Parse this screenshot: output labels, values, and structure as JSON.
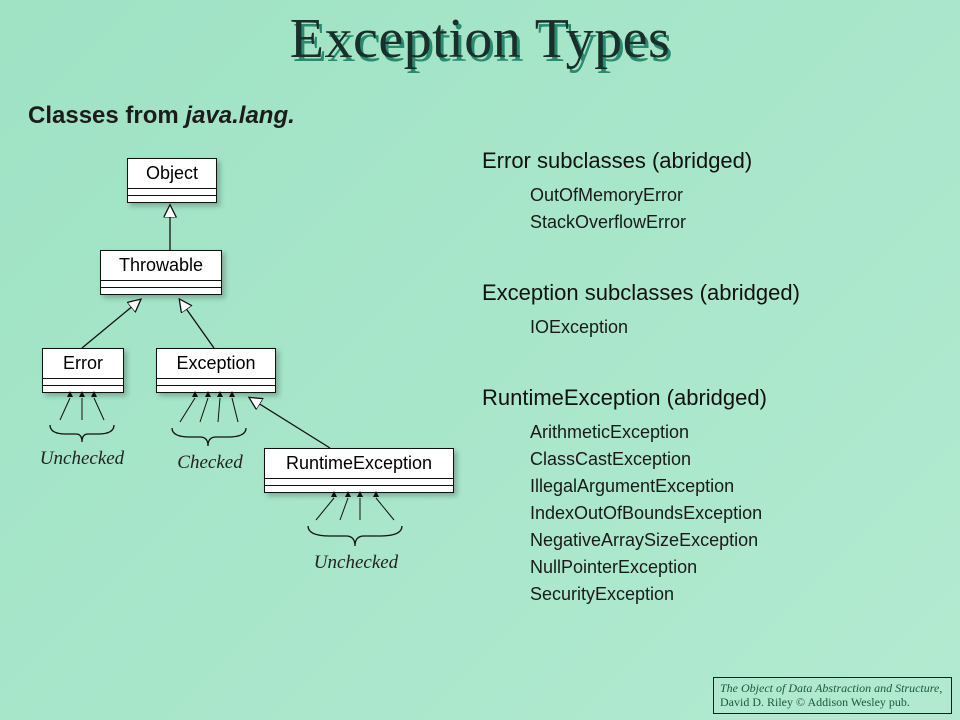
{
  "title": "Exception Types",
  "subtitle_prefix": "Classes from ",
  "subtitle_package": "java.lang.",
  "uml": {
    "object": "Object",
    "throwable": "Throwable",
    "error": "Error",
    "exception": "Exception",
    "runtime": "RuntimeException"
  },
  "labels": {
    "unchecked_error": "Unchecked",
    "checked": "Checked",
    "unchecked_runtime": "Unchecked"
  },
  "sections": [
    {
      "heading": "Error subclasses (abridged)",
      "items": [
        "OutOfMemoryError",
        "StackOverflowError"
      ]
    },
    {
      "heading": "Exception subclasses (abridged)",
      "items": [
        "IOException"
      ]
    },
    {
      "heading": "RuntimeException (abridged)",
      "items": [
        "ArithmeticException",
        "ClassCastException",
        "IllegalArgumentException",
        "IndexOutOfBoundsException",
        "NegativeArraySizeException",
        "NullPointerException",
        "SecurityException"
      ]
    }
  ],
  "footer": {
    "book": "The Object of Data Abstraction and Structure",
    "rest": ", David D. Riley © Addison Wesley pub."
  }
}
